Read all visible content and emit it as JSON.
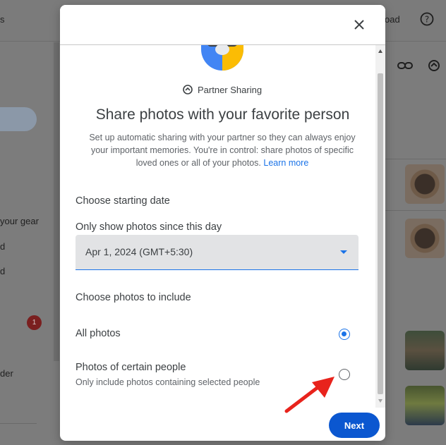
{
  "background": {
    "topbar_partial_left": "s",
    "topbar_partial_right": "oad",
    "sidebar_texts": [
      "your gear",
      "d",
      "d",
      "der"
    ],
    "badge_count": "1"
  },
  "dialog": {
    "brand_label": "Partner Sharing",
    "title": "Share photos with your favorite person",
    "description": "Set up automatic sharing with your partner so they can always enjoy your important memories. You're in control: share photos of specific loved ones or all of your photos.",
    "learn_more": "Learn more",
    "starting_date_title": "Choose starting date",
    "date_field_label": "Only show photos since this day",
    "date_value": "Apr 1, 2024 (GMT+5:30)",
    "include_title": "Choose photos to include",
    "options": [
      {
        "label": "All photos",
        "sublabel": "",
        "selected": true
      },
      {
        "label": "Photos of certain people",
        "sublabel": "Only include photos containing selected people",
        "selected": false
      }
    ],
    "next_label": "Next"
  },
  "colors": {
    "accent": "#1a73e8",
    "primary_button": "#0b57d0",
    "annotation_arrow": "#e8231c"
  },
  "icons": [
    "close-icon",
    "help-icon",
    "link-icon",
    "partner-sharing-icon",
    "dropdown-caret-icon"
  ]
}
